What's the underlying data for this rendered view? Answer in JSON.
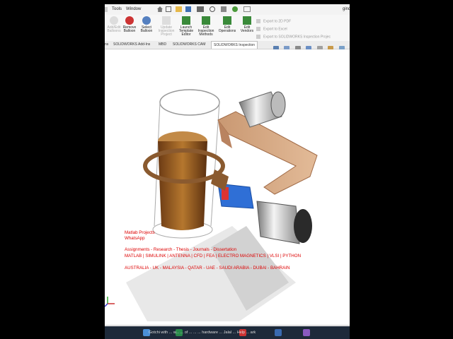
{
  "menubar": {
    "tools": "Tools",
    "window": "Window",
    "right": "gind"
  },
  "ribbon": {
    "add_edit_balloons": "Add/Edit\nBalloons",
    "remove_balloons": "Remove\nBalloon",
    "select_balloons": "Select\nBalloon",
    "update_inspection_project": "Update\nInspection\nProject",
    "launch_template_editor": "Launch\nTemplate\nEditor",
    "edit_inspection_methods": "Edit\nInspection\nMethods",
    "edit_operations": "Edit\nOperations",
    "edit_vendors": "Edit\nVendors",
    "export_2d_pdf": "Export to 2D PDF",
    "export_excel": "Export to Excel",
    "export_sw_inspection": "Export to SOLIDWORKS Inspection Projec"
  },
  "tabs": [
    {
      "label": "ns"
    },
    {
      "label": "SOLIDWORKS Add-Ins"
    },
    {
      "label": "MBD"
    },
    {
      "label": "SOLIDWORKS CAM"
    },
    {
      "label": "SOLIDWORKS Inspection"
    }
  ],
  "watermark": {
    "line1": "Matlab Projects",
    "line2": "WhatsApp",
    "line3": "Assignments - Research - Thesis - Journals - Dissertation",
    "line4": "MATLAB | SIMULINK | ANTENNA | CFD | FEA | ELECTRO MAGNETICS | VLSI | PYTHON",
    "line5": "AUSTRALIA - UK - MALAYSIA - QATAR - UAE - SAUDI ARABIA - DUBAI - BAHRAIN"
  },
  "taskbar_text": "Gotchi with ... w... ... of ... ... ... hardware ... Jalal ... Help ... ark"
}
